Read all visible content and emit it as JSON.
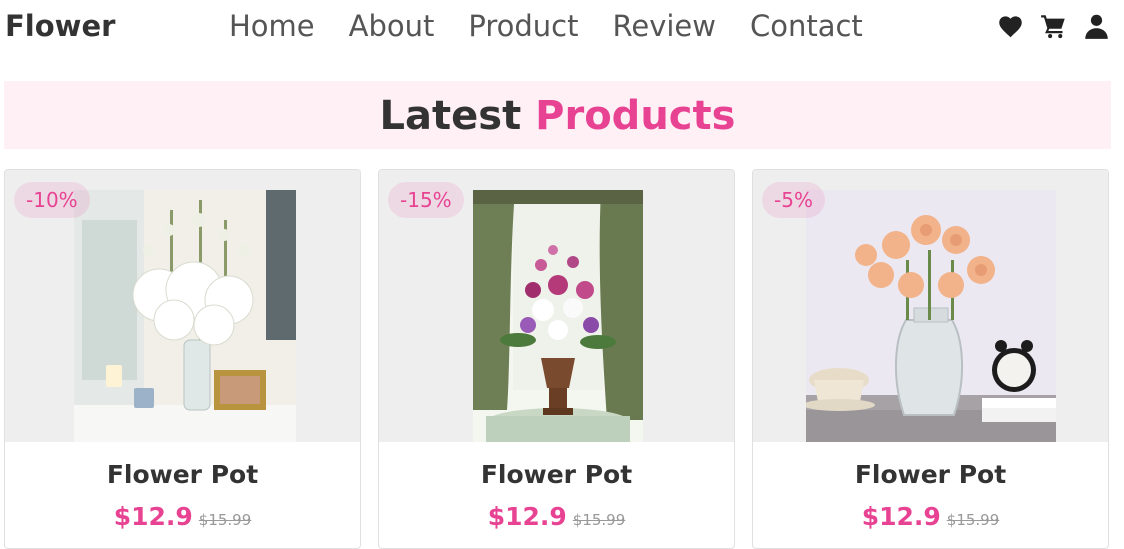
{
  "brand": {
    "logo": "Flower"
  },
  "nav": [
    "Home",
    "About",
    "Product",
    "Review",
    "Contact"
  ],
  "icons": [
    "heart-icon",
    "cart-icon",
    "user-icon"
  ],
  "section": {
    "title_plain": "Latest",
    "title_accent": "Products"
  },
  "colors": {
    "accent": "#e84393",
    "heading_bg": "#fff0f6",
    "image_bg": "#eeeeee"
  },
  "products": [
    {
      "discount": "-10%",
      "name": "Flower Pot",
      "price": "$12.9",
      "old_price": "$15.99"
    },
    {
      "discount": "-15%",
      "name": "Flower Pot",
      "price": "$12.9",
      "old_price": "$15.99"
    },
    {
      "discount": "-5%",
      "name": "Flower Pot",
      "price": "$12.9",
      "old_price": "$15.99"
    }
  ]
}
